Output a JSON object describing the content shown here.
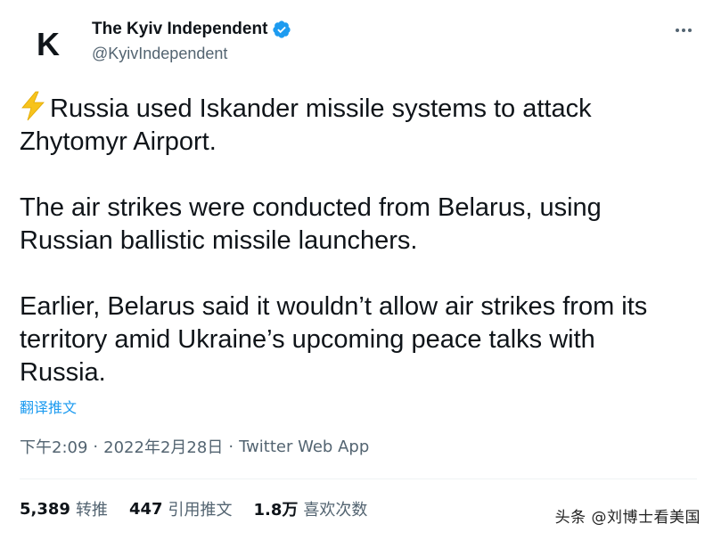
{
  "author": {
    "avatar_letter": "K",
    "display_name": "The Kyiv Independent",
    "handle": "@KyivIndependent",
    "verified_color": "#1d9bf0"
  },
  "tweet": {
    "paragraphs": [
      "Russia used Iskander missile systems to attack\nZhytomyr Airport.",
      "The air strikes were conducted from Belarus, using\nRussian ballistic missile launchers.",
      "Earlier, Belarus said it wouldn’t allow air strikes from its\nterritory amid Ukraine’s upcoming peace talks with\nRussia."
    ],
    "leading_emoji": "high-voltage-icon",
    "translate_label": "翻译推文"
  },
  "meta": {
    "time": "下午2:09",
    "separator": "·",
    "date": "2022年2月28日",
    "client": "Twitter Web App"
  },
  "stats": {
    "retweets_count": "5,389",
    "retweets_label": "转推",
    "quotes_count": "447",
    "quotes_label": "引用推文",
    "likes_count": "1.8万",
    "likes_label": "喜欢次数"
  },
  "watermark": "头条 @刘博士看美国",
  "colors": {
    "text": "#0f1419",
    "secondary": "#536471",
    "link": "#1d9bf0",
    "emoji": "#f7c31c"
  }
}
